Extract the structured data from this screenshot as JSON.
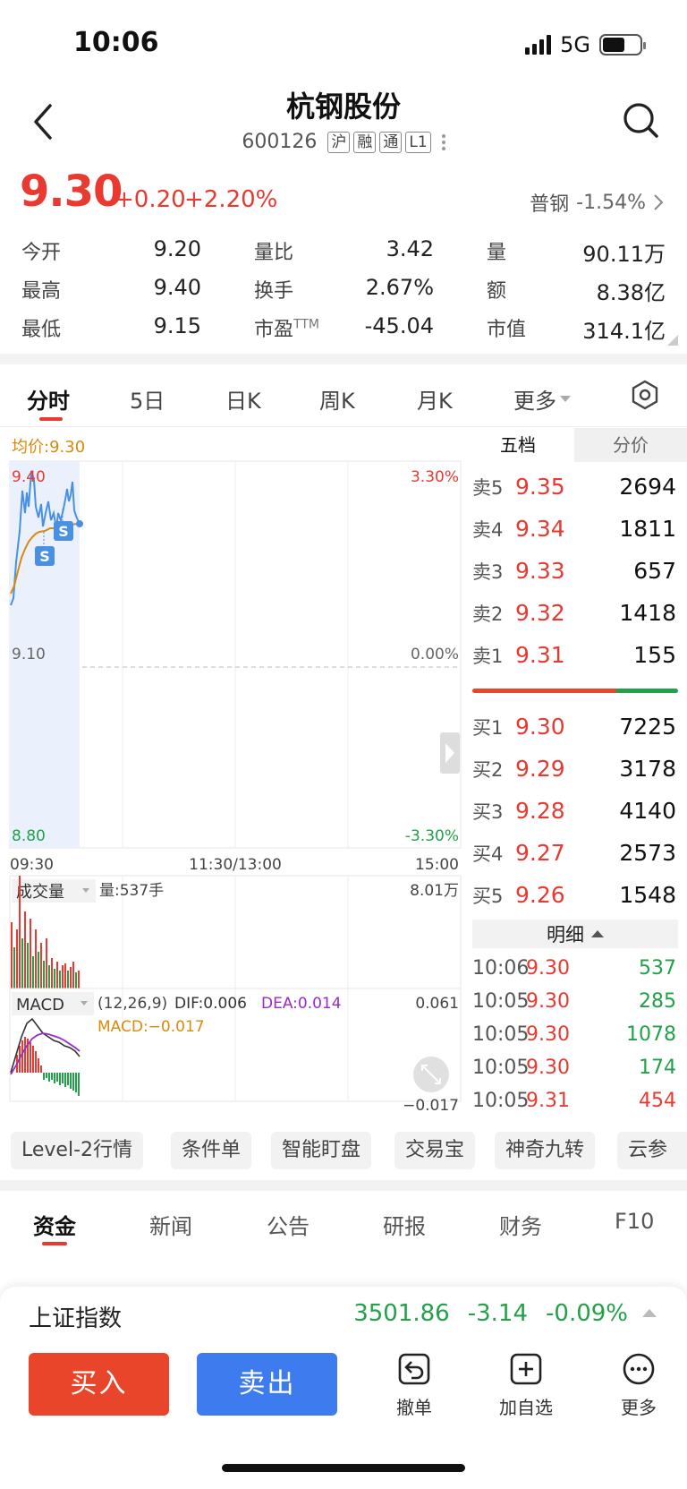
{
  "status_bar": {
    "time": "10:06",
    "network": "5G"
  },
  "header": {
    "name": "杭钢股份",
    "code": "600126",
    "tags": [
      "沪",
      "融",
      "通",
      "L1"
    ]
  },
  "quote": {
    "price": "9.30",
    "change": "+0.20",
    "change_pct": "+2.20%",
    "sector_name": "普钢",
    "sector_change": "-1.54%"
  },
  "stats": {
    "open_label": "今开",
    "open": "9.20",
    "high_label": "最高",
    "high": "9.40",
    "low_label": "最低",
    "low": "9.15",
    "vr_label": "量比",
    "vr": "3.42",
    "turnover_label": "换手",
    "turnover": "2.67%",
    "pe_label": "市盈",
    "pe_sup": "TTM",
    "pe": "-45.04",
    "vol_label": "量",
    "vol": "90.11万",
    "amount_label": "额",
    "amount": "8.38亿",
    "mcap_label": "市值",
    "mcap": "314.1亿"
  },
  "chart_tabs": [
    "分时",
    "5日",
    "日K",
    "周K",
    "月K",
    "更多"
  ],
  "chart": {
    "avg_price_label": "均价:9.30",
    "y_high": "9.40",
    "y_mid": "9.10",
    "y_low": "8.80",
    "pct_high": "3.30%",
    "pct_mid": "0.00%",
    "pct_low": "-3.30%",
    "time_start": "09:30",
    "time_mid": "11:30/13:00",
    "time_end": "15:00",
    "volume_label": "成交量",
    "volume_value": "量:537手",
    "volume_max": "8.01万",
    "macd_label": "MACD",
    "macd_params": "(12,26,9)",
    "dif": "DIF:0.006",
    "dea": "DEA:0.014",
    "macd_value": "MACD:−0.017",
    "macd_max": "0.061",
    "macd_min": "−0.017",
    "marker": "S"
  },
  "order_book": {
    "tabs": [
      "五档",
      "分价"
    ],
    "asks": [
      {
        "label": "卖5",
        "price": "9.35",
        "vol": "2694"
      },
      {
        "label": "卖4",
        "price": "9.34",
        "vol": "1811"
      },
      {
        "label": "卖3",
        "price": "9.33",
        "vol": "657"
      },
      {
        "label": "卖2",
        "price": "9.32",
        "vol": "1418"
      },
      {
        "label": "卖1",
        "price": "9.31",
        "vol": "155"
      }
    ],
    "bids": [
      {
        "label": "买1",
        "price": "9.30",
        "vol": "7225"
      },
      {
        "label": "买2",
        "price": "9.29",
        "vol": "3178"
      },
      {
        "label": "买3",
        "price": "9.28",
        "vol": "4140"
      },
      {
        "label": "买4",
        "price": "9.27",
        "vol": "2573"
      },
      {
        "label": "买5",
        "price": "9.26",
        "vol": "1548"
      }
    ],
    "detail_label": "明细",
    "details": [
      {
        "time": "10:06",
        "price": "9.30",
        "vol": "537"
      },
      {
        "time": "10:05",
        "price": "9.30",
        "vol": "285"
      },
      {
        "time": "10:05",
        "price": "9.30",
        "vol": "1078"
      },
      {
        "time": "10:05",
        "price": "9.30",
        "vol": "174"
      },
      {
        "time": "10:05",
        "price": "9.31",
        "vol": "454"
      }
    ]
  },
  "tools": [
    "Level-2行情",
    "条件单",
    "智能盯盘",
    "交易宝",
    "神奇九转",
    "云参"
  ],
  "news_tabs": [
    "资金",
    "新闻",
    "公告",
    "研报",
    "财务",
    "F10"
  ],
  "index": {
    "name": "上证指数",
    "value": "3501.86",
    "change": "-3.14",
    "change_pct": "-0.09%"
  },
  "actions": {
    "buy": "买入",
    "sell": "卖出",
    "cancel": "撤单",
    "watch": "加自选",
    "more": "更多"
  },
  "colors": {
    "up": "#e83a30",
    "down": "#22a04a",
    "sell_button": "#3d7bef",
    "buy_button": "#e8452a",
    "avg_line": "#d98b0c"
  }
}
